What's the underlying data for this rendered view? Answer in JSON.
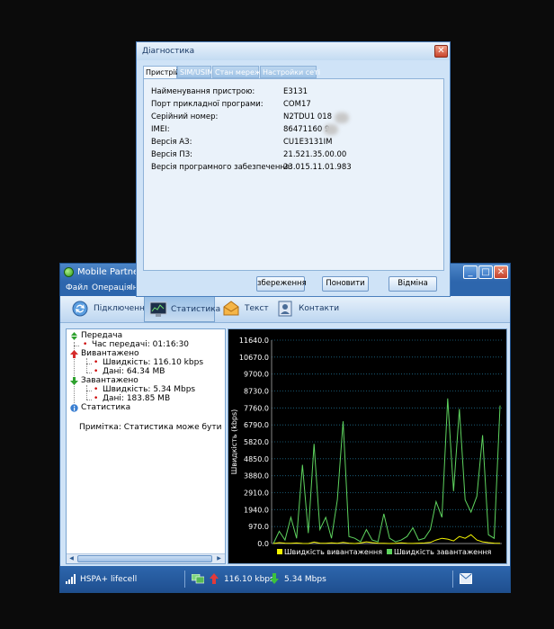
{
  "main_window": {
    "title": "Mobile Partner",
    "menu": [
      "Файл",
      "Операція",
      "Ін"
    ],
    "tabs": [
      {
        "label": "Підключення",
        "icon": "connection-icon"
      },
      {
        "label": "Статистика",
        "icon": "statistics-icon"
      },
      {
        "label": "Текст",
        "icon": "sms-envelope-icon"
      },
      {
        "label": "Контакти",
        "icon": "contacts-icon"
      }
    ],
    "active_tab": "Статистика"
  },
  "tree": {
    "transfer": {
      "label": "Передача",
      "time": "Час передачі: 01:16:30"
    },
    "upload": {
      "label": "Вивантажено",
      "speed": "Швидкість: 116.10 kbps",
      "data": "Дані: 64.34 MB"
    },
    "download": {
      "label": "Завантажено",
      "speed": "Швидкість: 5.34 Mbps",
      "data": "Дані: 183.85 MB"
    },
    "stats": {
      "label": "Статистика"
    },
    "note": "Примітка: Статистика може бути не точною"
  },
  "chart_data": {
    "type": "line",
    "ylabel": "Швидкість (kbps)",
    "y_ticks": [
      "11640.0",
      "10670.0",
      "9700.0",
      "8730.0",
      "7760.0",
      "6790.0",
      "5820.0",
      "4850.0",
      "3880.0",
      "2910.0",
      "1940.0",
      "970.0",
      "0.0"
    ],
    "ylim": [
      0,
      11640
    ],
    "grid": true,
    "legend_position": "bottom",
    "series": [
      {
        "name": "Швидкість вивантаження",
        "color": "#f4f400",
        "values": [
          0,
          50,
          20,
          10,
          30,
          5,
          0,
          80,
          20,
          10,
          40,
          10,
          60,
          20,
          0,
          30,
          100,
          50,
          20,
          10,
          0,
          15,
          40,
          10,
          5,
          20,
          30,
          60,
          200,
          300,
          250,
          150,
          400,
          300,
          500,
          200,
          100,
          50,
          20,
          10
        ]
      },
      {
        "name": "Швидкість завантаження",
        "color": "#5ed35e",
        "values": [
          0,
          700,
          200,
          1500,
          300,
          4500,
          600,
          5700,
          800,
          1500,
          300,
          2500,
          7000,
          400,
          300,
          100,
          800,
          200,
          100,
          1700,
          300,
          100,
          200,
          400,
          900,
          200,
          300,
          800,
          2400,
          1500,
          8300,
          3000,
          7700,
          2500,
          1800,
          2700,
          6200,
          500,
          300,
          7900
        ]
      }
    ]
  },
  "status_bar": {
    "network": "HSPA+",
    "operator": "lifecell",
    "upload_speed": "116.10 kbps",
    "download_speed": "5.34 Mbps"
  },
  "dialog": {
    "title": "Діагностика",
    "tabs": [
      "Пристрій",
      "SIM/USIM",
      "Стан мережі",
      "Настройки сеті"
    ],
    "active_tab": "Пристрій",
    "rows": [
      {
        "label": "Найменування пристрою:",
        "value": "E3131"
      },
      {
        "label": "Порт прикладної програми:",
        "value": "COM17"
      },
      {
        "label": "Серійний номер:",
        "value": "N2TDU1        018"
      },
      {
        "label": "IMEI:",
        "value": "86471160        9"
      },
      {
        "label": "Версія АЗ:",
        "value": "CU1E3131IM"
      },
      {
        "label": "Версія ПЗ:",
        "value": "21.521.35.00.00"
      },
      {
        "label": "Версія програмного забезпечення:",
        "value": "23.015.11.01.983"
      }
    ],
    "buttons": {
      "save": "збереження",
      "refresh": "Поновити",
      "cancel": "Відміна"
    }
  }
}
